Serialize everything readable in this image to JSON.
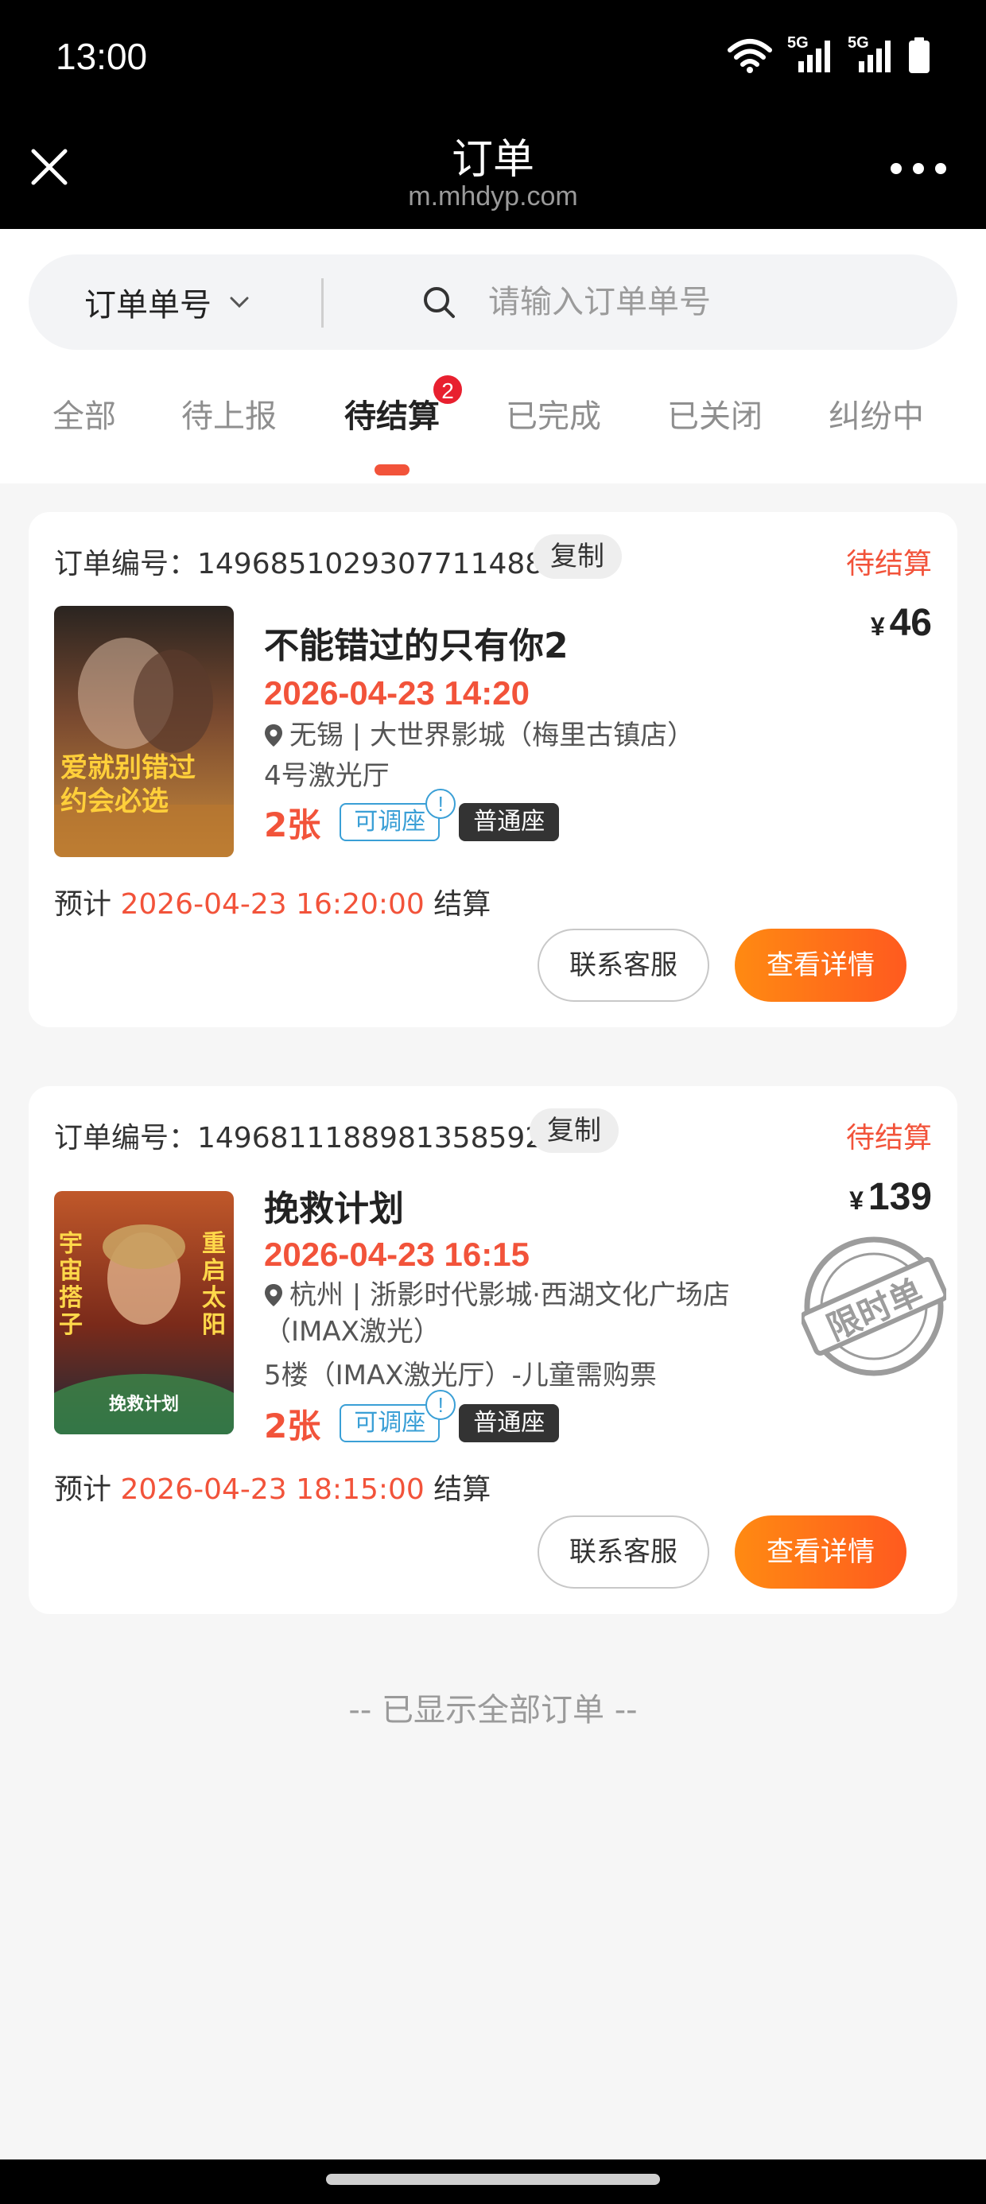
{
  "status_bar": {
    "time": "13:00",
    "signal_1": "5G",
    "signal_2": "5G"
  },
  "header": {
    "title": "订单",
    "subtitle": "m.mhdyp.com"
  },
  "search": {
    "type_label": "订单单号",
    "placeholder": "请输入订单单号"
  },
  "tabs": [
    {
      "label": "全部"
    },
    {
      "label": "待上报"
    },
    {
      "label": "待结算",
      "badge": "2",
      "active": true
    },
    {
      "label": "已完成"
    },
    {
      "label": "已关闭"
    },
    {
      "label": "纠纷中"
    }
  ],
  "orders": [
    {
      "order_no_label": "订单编号：1496851029307711488",
      "copy_label": "复制",
      "status": "待结算",
      "price_symbol": "¥",
      "price": "46",
      "movie_title": "不能错过的只有你2",
      "show_time": "2026-04-23 14:20",
      "venue": "无锡 | 大世界影城（梅里古镇店）",
      "hall": "4号激光厅",
      "ticket_count": "2张",
      "adjust_tag": "可调座",
      "seat_type": "普通座",
      "settle_prefix": "预计",
      "settle_time": "2026-04-23 16:20:00",
      "settle_suffix": "结算",
      "contact_label": "联系客服",
      "detail_label": "查看详情",
      "poster_text": [
        "爱就别错过",
        "约会必选"
      ]
    },
    {
      "order_no_label": "订单编号：1496811188981358592",
      "copy_label": "复制",
      "status": "待结算",
      "price_symbol": "¥",
      "price": "139",
      "movie_title": "挽救计划",
      "show_time": "2026-04-23 16:15",
      "venue_line1": "杭州 | 浙影时代影城·西湖文化广场店",
      "venue_line2": "（IMAX激光）",
      "hall": "5楼（IMAX激光厅）-儿童需购票",
      "ticket_count": "2张",
      "adjust_tag": "可调座",
      "seat_type": "普通座",
      "settle_prefix": "预计",
      "settle_time": "2026-04-23 18:15:00",
      "settle_suffix": "结算",
      "contact_label": "联系客服",
      "detail_label": "查看详情",
      "stamp_text": "限时单",
      "poster_text": [
        "宇宙搭子",
        "重启太阳",
        "挽救计划"
      ]
    }
  ],
  "footer": {
    "end_text": "-- 已显示全部订单 --"
  },
  "colors": {
    "accent": "#f2533a",
    "badge": "#e8202f",
    "button_gradient_start": "#ff8a12",
    "button_gradient_end": "#ff5a1f",
    "tag_blue": "#3a9fd6"
  }
}
